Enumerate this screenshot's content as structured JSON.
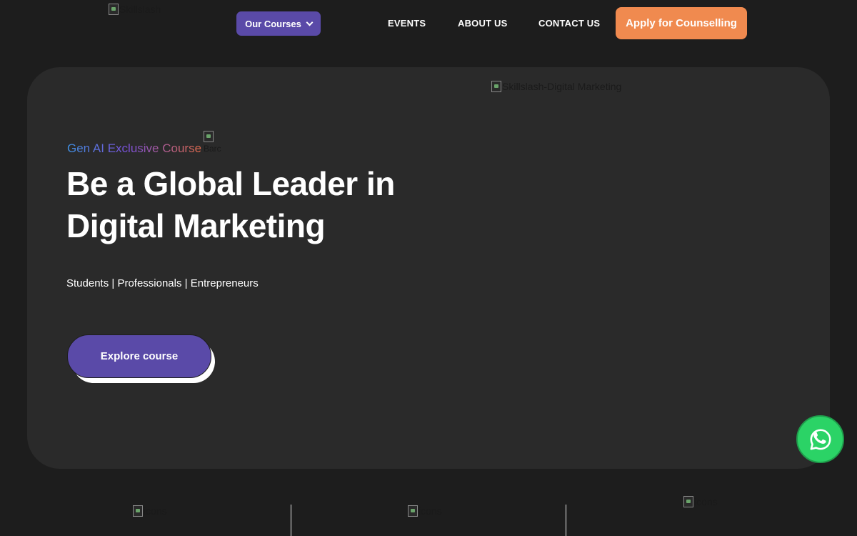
{
  "header": {
    "logo_alt": "Skillslash",
    "courses_label": "Our Courses",
    "nav": [
      "EVENTS",
      "ABOUT US",
      "CONTACT US"
    ],
    "cta_label": "Apply for Counselling"
  },
  "hero": {
    "image_alt": "Skillslash-Digital Marketing",
    "tagline": "Gen AI Exclusive Course",
    "badge_alt": "Barc",
    "title_line1": "Be a Global Leader in",
    "title_line2": "Digital Marketing",
    "audience": "Students | Professionals | Entrepreneurs",
    "explore_label": "Explore course"
  },
  "stats": {
    "icon_alt": [
      "icons",
      "icons",
      "icons"
    ]
  },
  "colors": {
    "background": "#1d1d1d",
    "hero_panel": "#2a2a2a",
    "primary": "#5a4aa8",
    "accent": "#f08a4f",
    "whatsapp": "#2bd366"
  },
  "icons": {
    "whatsapp": "whatsapp-icon",
    "dropdown": "chevron-down-icon"
  }
}
